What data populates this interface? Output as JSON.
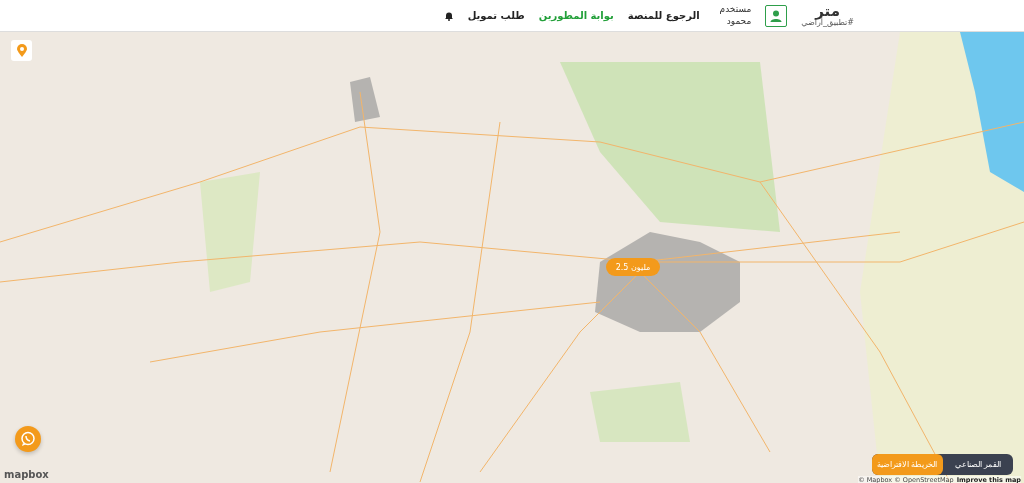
{
  "header": {
    "logo": {
      "mark": "متر",
      "tagline": "#تطبيق_أراضي"
    },
    "user": {
      "role": "مستخدم",
      "name": "محمود"
    },
    "nav": [
      {
        "label": "الرجوع للمنصة",
        "selected": false
      },
      {
        "label": "بوابة المطورين",
        "selected": true
      },
      {
        "label": "طلب تمويل",
        "selected": false
      }
    ]
  },
  "map": {
    "cluster": {
      "label": "2.5 مليون"
    },
    "layers": [
      {
        "label": "القمر الصناعي",
        "selected": false
      },
      {
        "label": "الخريطة الافتراضية",
        "selected": true
      }
    ],
    "brand": "mapbox",
    "attribution": {
      "text": "© Mapbox © OpenStreetMap",
      "link": "Improve this map"
    }
  }
}
